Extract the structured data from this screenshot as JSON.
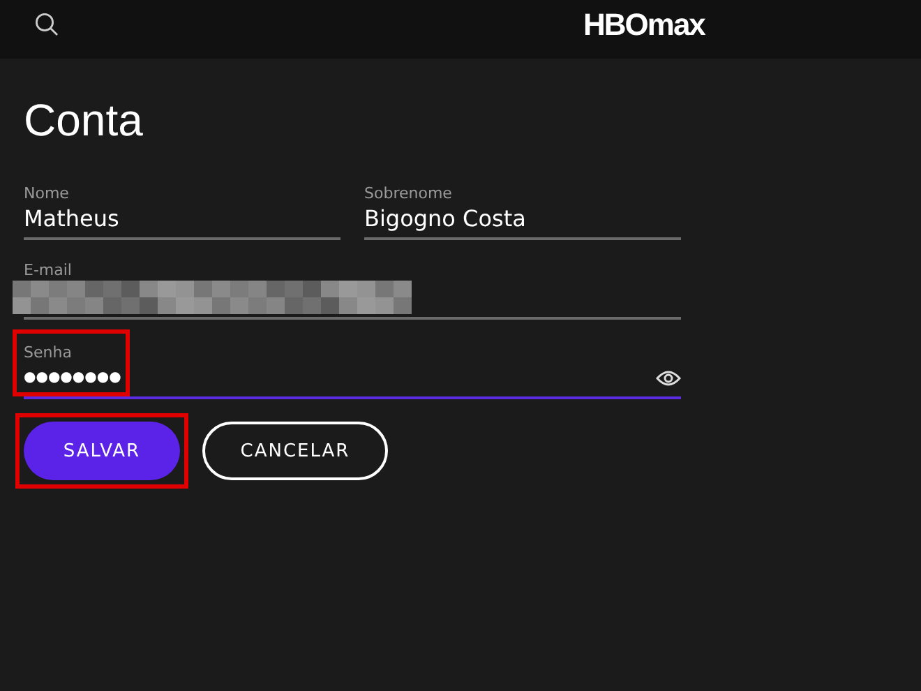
{
  "header": {
    "logo": "HBOmax"
  },
  "title": "Conta",
  "fields": [
    {
      "kind": "text",
      "label": "Nome",
      "value": "Matheus",
      "focused": false,
      "highlighted": false
    },
    {
      "kind": "text",
      "label": "Sobrenome",
      "value": "Bigogno Costa",
      "focused": false,
      "highlighted": false
    },
    {
      "kind": "redacted",
      "label": "E-mail",
      "focused": false,
      "highlighted": false
    },
    {
      "kind": "password",
      "label": "Senha",
      "value": "●●●●●●●●",
      "focused": true,
      "highlighted": true
    }
  ],
  "buttons": [
    {
      "kind": "primary",
      "label": "SALVAR",
      "highlighted": true
    },
    {
      "kind": "outline",
      "label": "CANCELAR",
      "highlighted": false
    }
  ]
}
